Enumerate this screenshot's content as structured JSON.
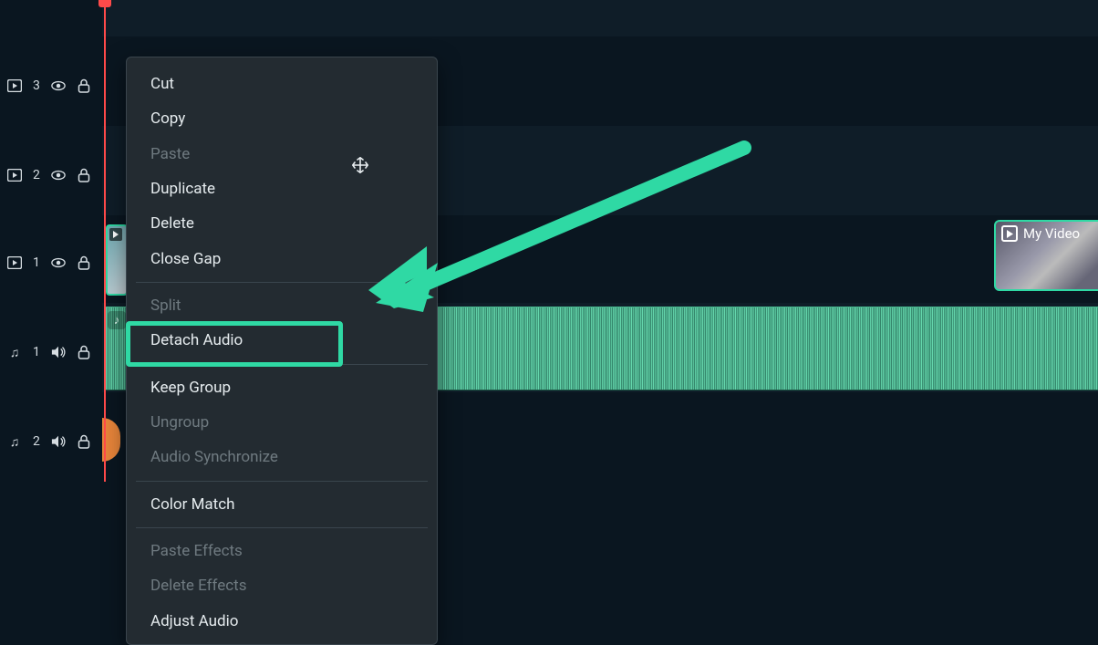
{
  "tracks": {
    "video3": {
      "label": "3"
    },
    "video2": {
      "label": "2"
    },
    "video1": {
      "label": "1"
    },
    "audio1": {
      "label": "1"
    },
    "audio2": {
      "label": "2"
    }
  },
  "clip": {
    "right_video_label": "My Video"
  },
  "context_menu": {
    "cut": "Cut",
    "copy": "Copy",
    "paste": "Paste",
    "duplicate": "Duplicate",
    "delete": "Delete",
    "close_gap": "Close Gap",
    "split": "Split",
    "detach_audio": "Detach Audio",
    "keep_group": "Keep Group",
    "ungroup": "Ungroup",
    "audio_synchronize": "Audio Synchronize",
    "color_match": "Color Match",
    "paste_effects": "Paste Effects",
    "delete_effects": "Delete Effects",
    "adjust_audio": "Adjust Audio"
  },
  "annotation": {
    "highlight_target": "Audio Synchronize",
    "arrow_color": "#2fd9a4"
  }
}
